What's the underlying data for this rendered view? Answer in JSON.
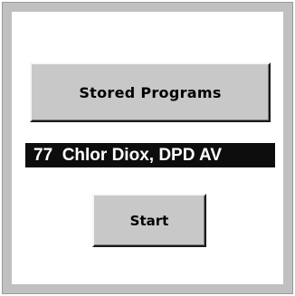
{
  "buttons": {
    "stored_programs_label": "Stored Programs",
    "start_label": "Start"
  },
  "selected_program": {
    "number": "77",
    "name": "Chlor Diox, DPD AV"
  },
  "colors": {
    "frame": "#c0c0c0",
    "panel": "#ffffff",
    "button_face": "#c8c8c8",
    "program_bar": "#0d0d0d",
    "program_text": "#ffffff"
  }
}
